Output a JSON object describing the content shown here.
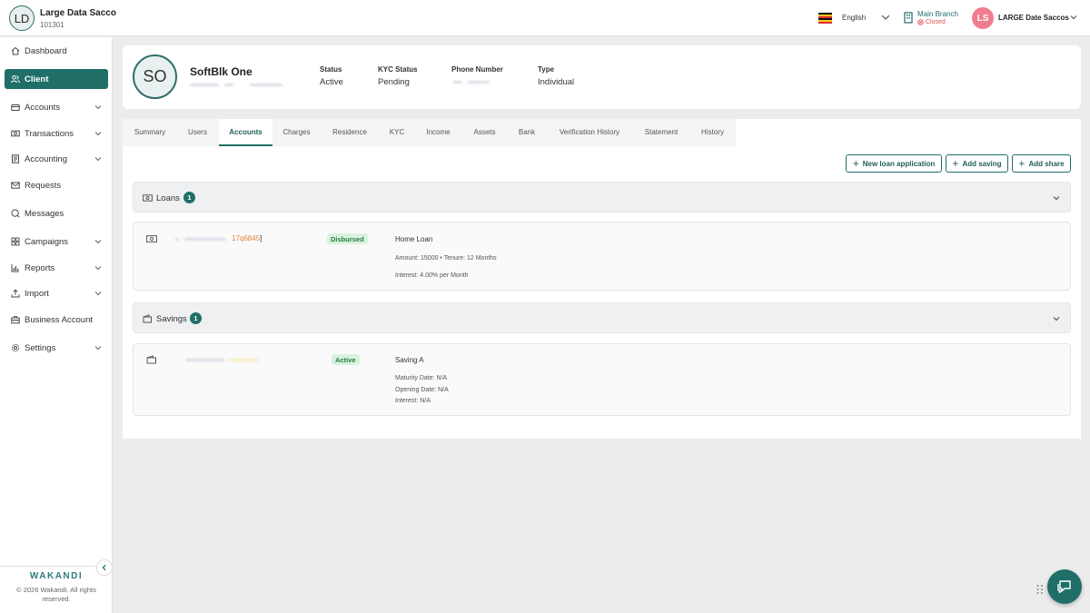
{
  "header": {
    "org_initials": "LD",
    "org_name": "Large Data Sacco",
    "org_code": "101301",
    "language": "English",
    "branch_name": "Main Branch",
    "branch_status": "Closed",
    "user_initials": "LS",
    "user_name": "LARGE Date Saccos"
  },
  "sidebar": {
    "items": [
      {
        "label": "Dashboard",
        "icon": "home-icon",
        "active": false,
        "has_children": false
      },
      {
        "label": "Client",
        "icon": "users-icon",
        "active": true,
        "has_children": false
      },
      {
        "label": "Accounts",
        "icon": "wallet-icon",
        "active": false,
        "has_children": true
      },
      {
        "label": "Transactions",
        "icon": "cash-icon",
        "active": false,
        "has_children": true
      },
      {
        "label": "Accounting",
        "icon": "ledger-icon",
        "active": false,
        "has_children": true
      },
      {
        "label": "Requests",
        "icon": "mail-icon",
        "active": false,
        "has_children": false
      },
      {
        "label": "Messages",
        "icon": "chat-icon",
        "active": false,
        "has_children": false
      },
      {
        "label": "Campaigns",
        "icon": "grid-icon",
        "active": false,
        "has_children": true
      },
      {
        "label": "Reports",
        "icon": "bar-chart-icon",
        "active": false,
        "has_children": true
      },
      {
        "label": "Import",
        "icon": "upload-icon",
        "active": false,
        "has_children": true
      },
      {
        "label": "Business Account",
        "icon": "briefcase-icon",
        "active": false,
        "has_children": false
      },
      {
        "label": "Settings",
        "icon": "gear-icon",
        "active": false,
        "has_children": true
      }
    ],
    "brand": "WAKANDI",
    "copyright": "© 2026 Wakandi. All rights reserved."
  },
  "client": {
    "initials": "SO",
    "name": "SoftBlk One",
    "status_label": "Status",
    "status_value": "Active",
    "kyc_label": "KYC Status",
    "kyc_value": "Pending",
    "phone_label": "Phone Number",
    "type_label": "Type",
    "type_value": "Individual"
  },
  "tabs": [
    {
      "label": "Summary",
      "active": false
    },
    {
      "label": "Users",
      "active": false
    },
    {
      "label": "Accounts",
      "active": true
    },
    {
      "label": "Charges",
      "active": false
    },
    {
      "label": "Residence",
      "active": false
    },
    {
      "label": "KYC",
      "active": false
    },
    {
      "label": "Income",
      "active": false
    },
    {
      "label": "Assets",
      "active": false
    },
    {
      "label": "Bank",
      "active": false
    },
    {
      "label": "Verification History",
      "active": false
    },
    {
      "label": "Statement",
      "active": false
    },
    {
      "label": "History",
      "active": false
    }
  ],
  "actions": {
    "new_loan": "New loan application",
    "add_saving": "Add saving",
    "add_share": "Add share"
  },
  "loans": {
    "title": "Loans",
    "count": "1",
    "item": {
      "ref_suffix": "17q6845",
      "status": "Disbursed",
      "product": "Home Loan",
      "amount_tenure": "Amount: 15000  •  Tenure: 12 Months",
      "interest": "Interest: 4.00% per Month"
    }
  },
  "savings": {
    "title": "Savings",
    "count": "1",
    "item": {
      "status": "Active",
      "product": "Saving A",
      "maturity": "Maturity Date: N/A",
      "opening": "Opening Date: N/A",
      "interest": "Interest: N/A"
    }
  },
  "colors": {
    "accent": "#1f6f68",
    "closed": "#e0524f",
    "status_green_bg": "#d9f2df",
    "ref_orange": "#e0803a"
  }
}
